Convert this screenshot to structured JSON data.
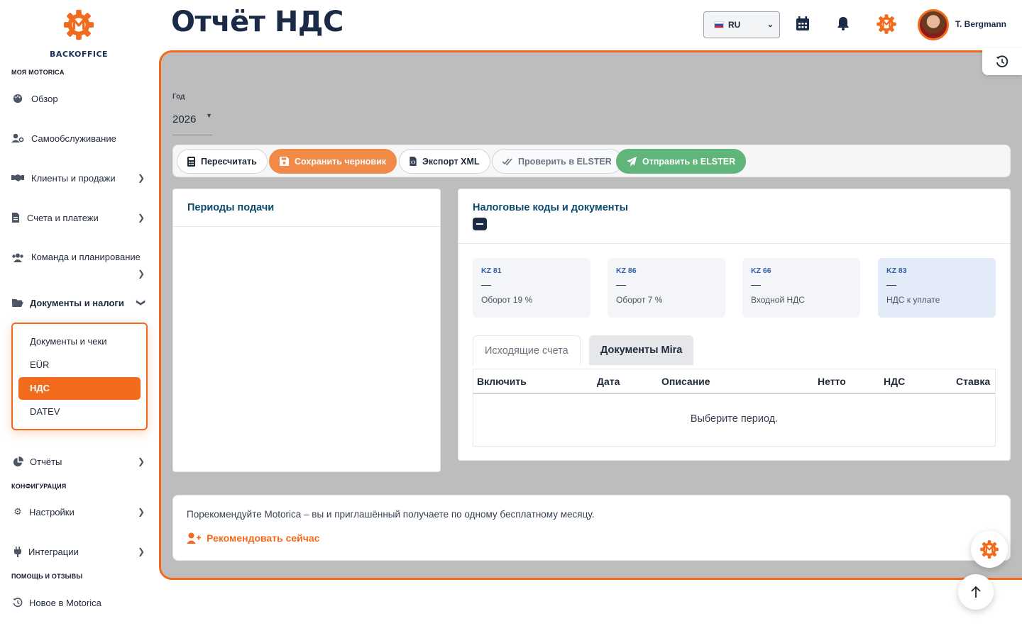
{
  "brand": {
    "logo_text": "BACKOFFICE",
    "accent_color": "#f26a1b",
    "navy_color": "#1b2a47"
  },
  "sidebar": {
    "section_my": "МОЯ MOTORICA",
    "overview": "Обзор",
    "selfservice": "Самообслуживание",
    "clients": "Клиенты и продажи",
    "invoices": "Счета и платежи",
    "team": "Команда и планирование",
    "documents": "Документы и налоги",
    "submenu": {
      "docs": "Документы и чеки",
      "eur": "EÜR",
      "vat": "НДС",
      "datev": "DATEV"
    },
    "reports": "Отчёты",
    "section_config": "КОНФИГУРАЦИЯ",
    "settings": "Настройки",
    "integrations": "Интеграции",
    "section_help": "ПОМОЩЬ И ОТЗЫВЫ",
    "news": "Новое в Motorica"
  },
  "header": {
    "title": "Отчёт НДС",
    "language": "RU",
    "user_name": "T. Bergmann"
  },
  "filters": {
    "year_label": "Год",
    "year_value": "2026"
  },
  "toolbar": {
    "recalc": "Пересчитать",
    "save_draft": "Сохранить черновик",
    "export_xml": "Экспорт XML",
    "check_elster": "Проверить в ELSTER",
    "send_elster": "Отправить в ELSTER"
  },
  "periods_card": {
    "title": "Периоды подачи"
  },
  "tax_card": {
    "title": "Налоговые коды и документы",
    "codes": [
      {
        "code": "KZ 81",
        "value": "—",
        "desc": "Оборот 19 %"
      },
      {
        "code": "KZ 86",
        "value": "—",
        "desc": "Оборот 7 %"
      },
      {
        "code": "KZ 66",
        "value": "—",
        "desc": "Входной НДС"
      },
      {
        "code": "KZ 83",
        "value": "—",
        "desc": "НДС к уплате"
      }
    ],
    "tabs": {
      "outgoing": "Исходящие счета",
      "mira": "Документы Mira"
    },
    "table": {
      "headers": [
        "Включить",
        "Дата",
        "Описание",
        "Нетто",
        "НДС",
        "Ставка"
      ],
      "empty": "Выберите период."
    }
  },
  "referral": {
    "text": "Порекомендуйте Motorica – вы и приглашённый получаете по одному бесплатному месяцу.",
    "link": "Рекомендовать сейчас"
  }
}
